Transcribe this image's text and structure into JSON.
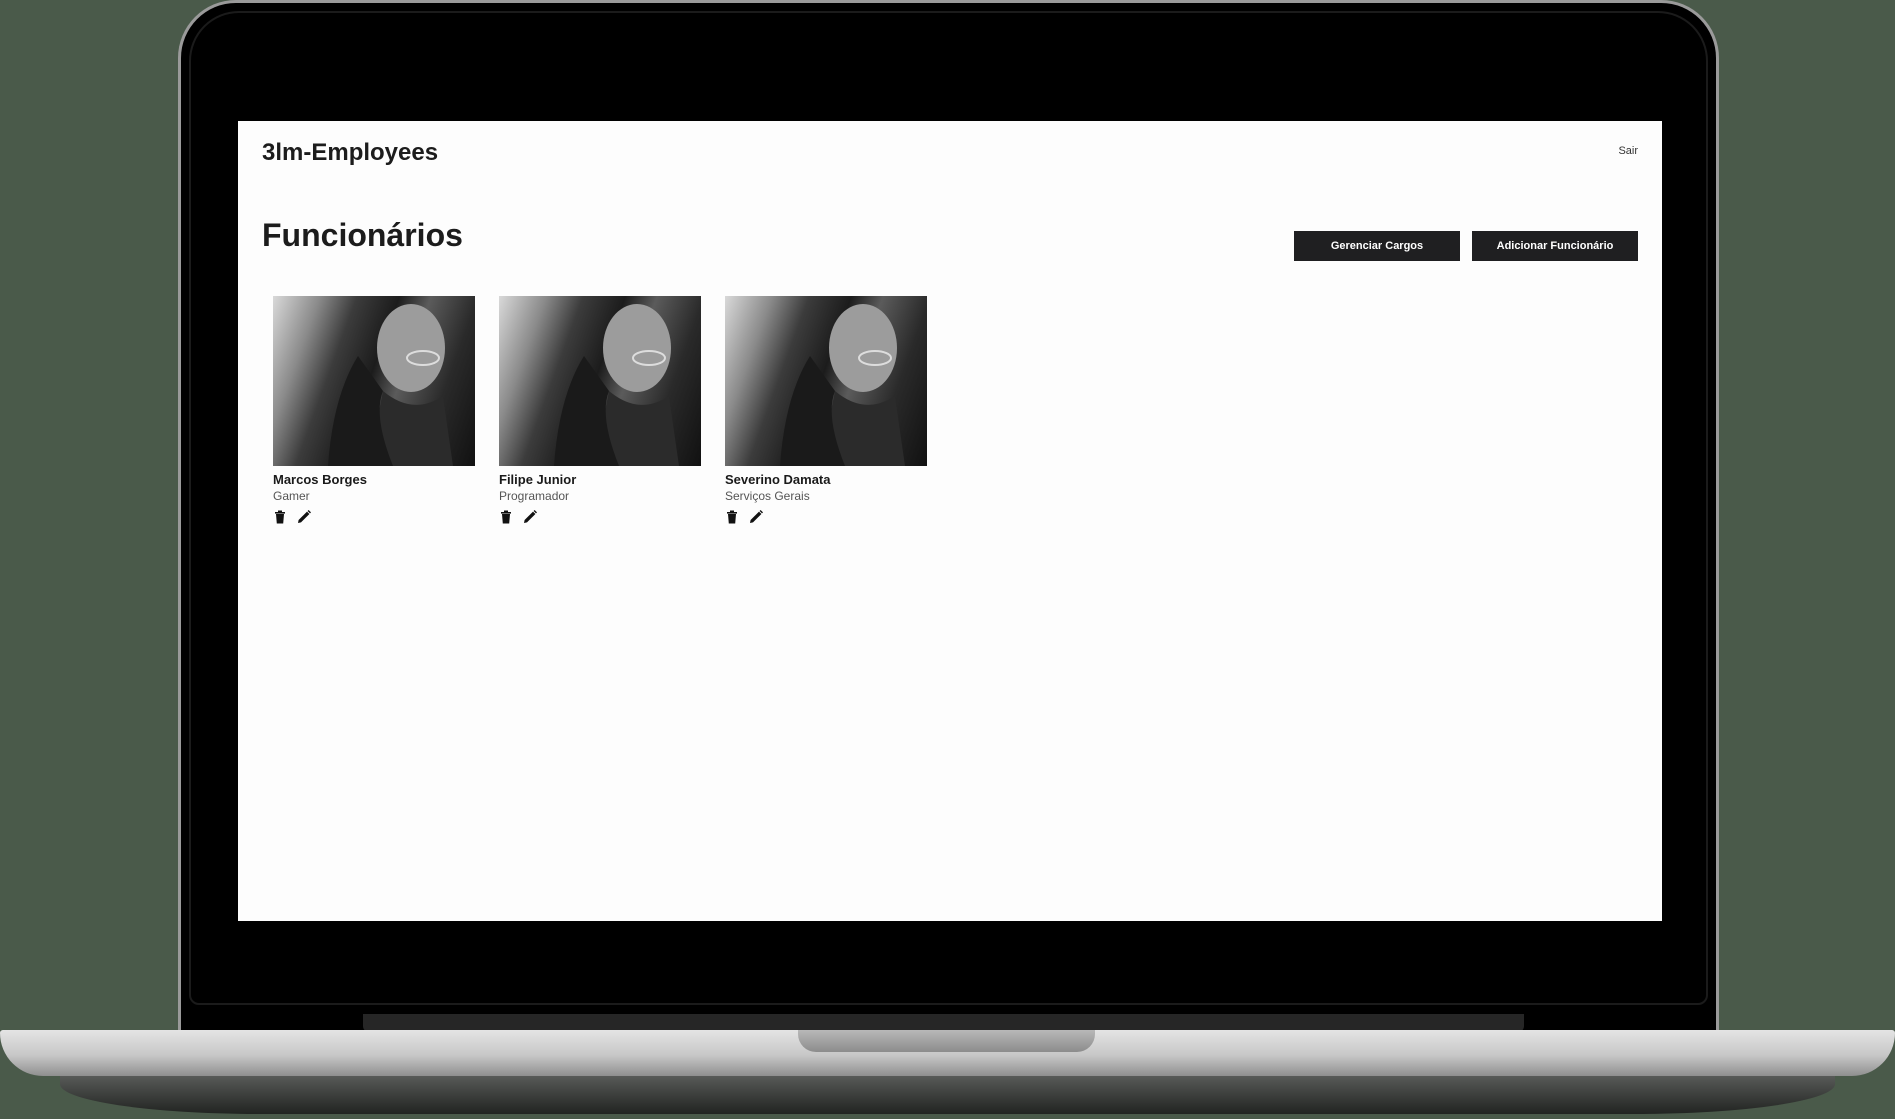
{
  "app": {
    "brand": "3lm-Employees",
    "logout_label": "Sair"
  },
  "page": {
    "title": "Funcionários"
  },
  "toolbar": {
    "manage_roles_label": "Gerenciar Cargos",
    "add_employee_label": "Adicionar Funcionário"
  },
  "employees": [
    {
      "name": "Marcos Borges",
      "role": "Gamer"
    },
    {
      "name": "Filipe Junior",
      "role": "Programador"
    },
    {
      "name": "Severino Damata",
      "role": "Serviços Gerais"
    }
  ],
  "icons": {
    "delete": "trash-icon",
    "edit": "pencil-icon"
  },
  "colors": {
    "button_bg": "#1f1f21",
    "button_text": "#ffffff",
    "screen_bg": "#fdfdfd"
  }
}
